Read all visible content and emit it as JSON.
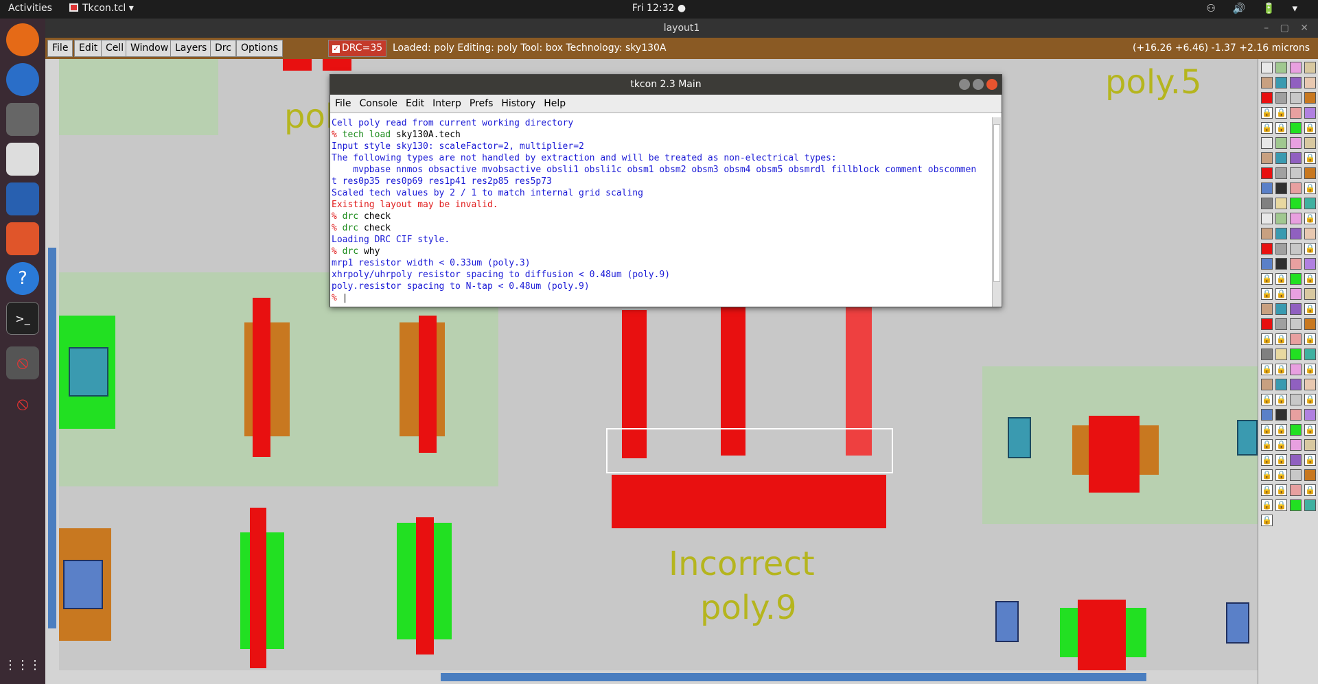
{
  "topbar": {
    "activities": "Activities",
    "app": "Tkcon.tcl ▾",
    "clock": "Fri 12:32 ●",
    "tray": "⚇ 🔊 🔋 ▾"
  },
  "window": {
    "title": "layout1",
    "controls": "– ▢ ✕"
  },
  "menus": [
    "File",
    "Edit",
    "Cell",
    "Window",
    "Layers",
    "Drc",
    "Options"
  ],
  "drc": {
    "label": "DRC=35",
    "checked": "✓"
  },
  "status": "Loaded: poly Editing: poly Tool: box  Technology: sky130A",
  "coords": "(+16.26 +6.46) -1.37 +2.16 microns",
  "tkcon": {
    "title": "tkcon 2.3 Main",
    "menus": [
      "File",
      "Console",
      "Edit",
      "Interp",
      "Prefs",
      "History",
      "Help"
    ]
  },
  "console": [
    {
      "cls": "",
      "t": "Cell poly read from current working directory"
    },
    {
      "cls": "p",
      "pre": "% ",
      "cmd": "tech load",
      "rest": " sky130A.tech"
    },
    {
      "cls": "",
      "t": "Input style sky130: scaleFactor=2, multiplier=2"
    },
    {
      "cls": "",
      "t": "The following types are not handled by extraction and will be treated as non-electrical types:"
    },
    {
      "cls": "",
      "t": "    mvpbase nnmos obsactive mvobsactive obsli1 obsli1c obsm1 obsm2 obsm3 obsm4 obsm5 obsmrdl fillblock comment obscommen"
    },
    {
      "cls": "",
      "t": "t res0p35 res0p69 res1p41 res2p85 res5p73"
    },
    {
      "cls": "",
      "t": "Scaled tech values by 2 / 1 to match internal grid scaling"
    },
    {
      "cls": "r",
      "t": "Existing layout may be invalid."
    },
    {
      "cls": "p",
      "pre": "% ",
      "cmd": "drc",
      "rest": " check"
    },
    {
      "cls": "p",
      "pre": "% ",
      "cmd": "drc",
      "rest": " check"
    },
    {
      "cls": "",
      "t": "Loading DRC CIF style."
    },
    {
      "cls": "p",
      "pre": "% ",
      "cmd": "drc",
      "rest": " why"
    },
    {
      "cls": "",
      "t": "mrp1 resistor width < 0.33um (poly.3)"
    },
    {
      "cls": "",
      "t": "xhrpoly/uhrpoly resistor spacing to diffusion < 0.48um (poly.9)"
    },
    {
      "cls": "",
      "t": "poly.resistor spacing to N-tap < 0.48um (poly.9)"
    },
    {
      "cls": "p",
      "pre": "% ",
      "cmd": "",
      "rest": ""
    }
  ],
  "labels": {
    "poly5": "poly.5",
    "poly_top": "pol",
    "incorrect": "Incorrect",
    "poly9": "poly.9"
  },
  "colors": {
    "poly": "#e81010",
    "diff": "#22e022",
    "ndiff": "#c87820",
    "nwell": "#a8d8a8",
    "contact": "#3a9ab0"
  }
}
